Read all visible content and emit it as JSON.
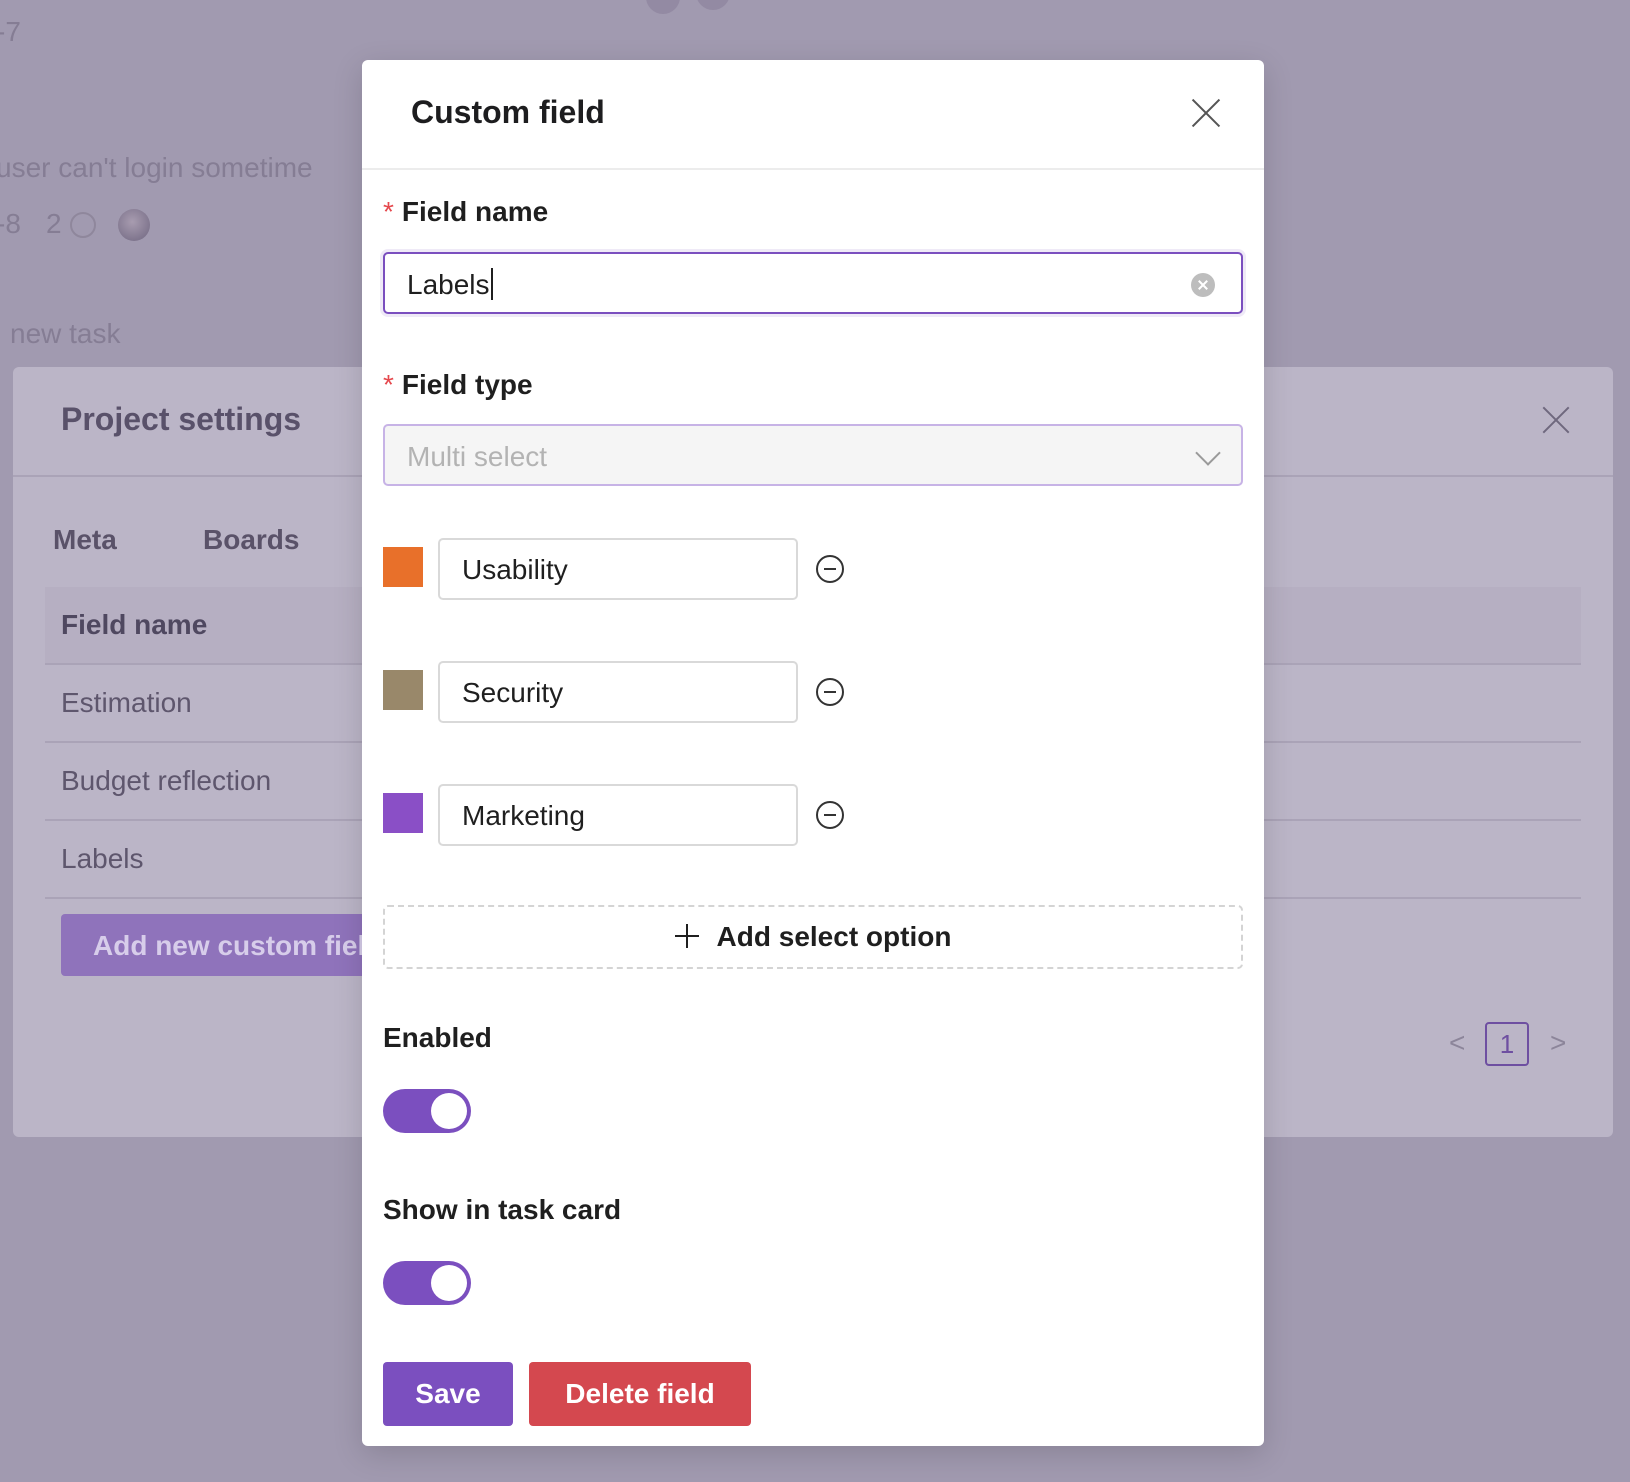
{
  "background": {
    "task_id_top": "-7",
    "task_title": "user can't login sometime",
    "task_id": "-8",
    "comment_count": "2",
    "new_task_text": "new task"
  },
  "project_settings": {
    "title": "Project settings",
    "tabs": [
      "Meta",
      "Boards"
    ],
    "table_header": "Field name",
    "rows": [
      "Estimation",
      "Budget reflection",
      "Labels"
    ],
    "add_button": "Add new custom field",
    "pagination": {
      "prev": "<",
      "current": "1",
      "next": ">"
    }
  },
  "modal": {
    "title": "Custom field",
    "field_name": {
      "required_mark": "*",
      "label": "Field name",
      "value": "Labels"
    },
    "field_type": {
      "required_mark": "*",
      "label": "Field type",
      "value": "Multi select"
    },
    "options": [
      {
        "label": "Usability",
        "color": "#e8702a"
      },
      {
        "label": "Security",
        "color": "#99886a"
      },
      {
        "label": "Marketing",
        "color": "#8a4fc6"
      }
    ],
    "add_option_label": "Add select option",
    "enabled": {
      "label": "Enabled",
      "on": true
    },
    "show_in_task_card": {
      "label": "Show in task card",
      "on": true
    },
    "save_label": "Save",
    "delete_label": "Delete field"
  },
  "colors": {
    "accent": "#7b4fbf",
    "danger": "#d4484f",
    "required": "#e5484d"
  }
}
